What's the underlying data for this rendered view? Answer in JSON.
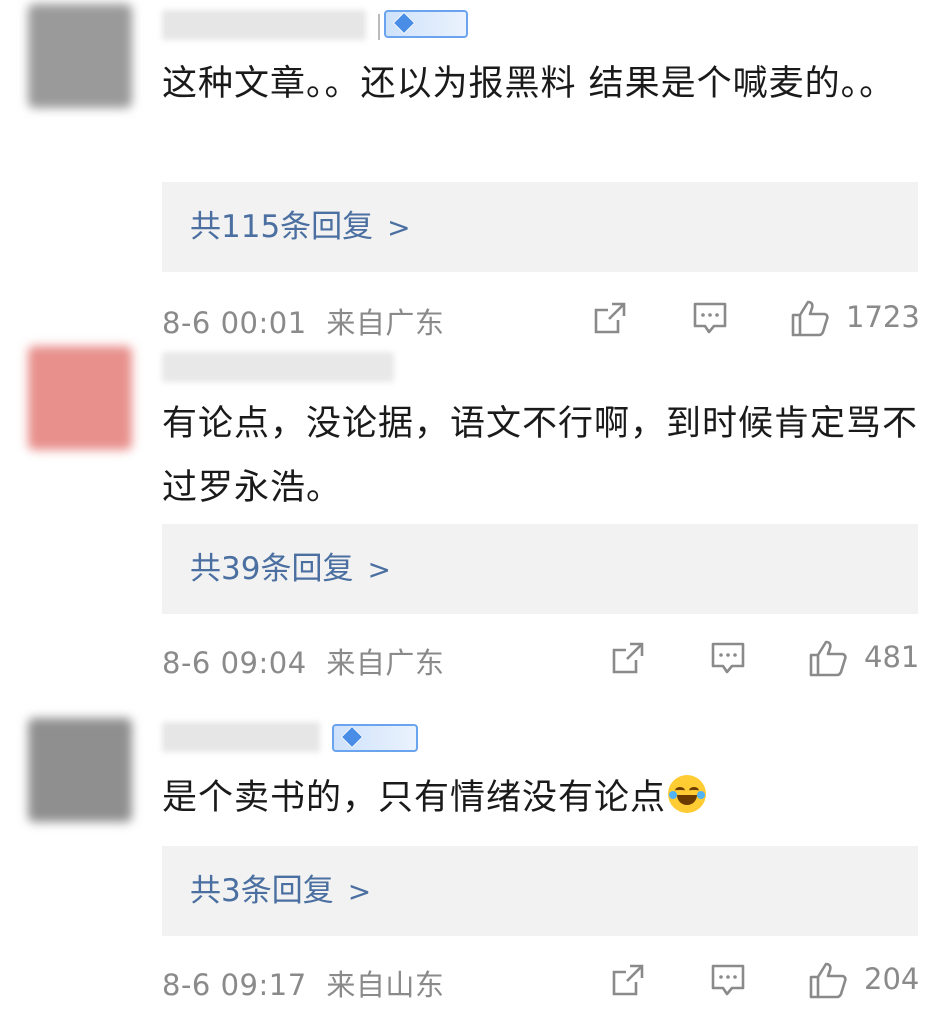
{
  "comments": [
    {
      "avatar_color": "#9a9a9a",
      "has_badge": true,
      "text": "这种文章。。还以为报黑料 结果是个喊麦的。。",
      "reply_label": "共115条回复",
      "time": "8-6 00:01",
      "location": "来自广东",
      "likes": "1723"
    },
    {
      "avatar_color": "#e8908c",
      "has_badge": false,
      "text": "有论点，没论据，语文不行啊，到时候肯定骂不过罗永浩。",
      "reply_label": "共39条回复",
      "time": "8-6 09:04",
      "location": "来自广东",
      "likes": "481"
    },
    {
      "avatar_color": "#8f8f8f",
      "has_badge": true,
      "text": "是个卖书的，只有情绪没有论点",
      "reply_label": "共3条回复",
      "time": "8-6 09:17",
      "location": "来自山东",
      "likes": "204"
    }
  ],
  "icons": {
    "repost": "repost-icon",
    "comment": "comment-icon",
    "like": "thumbs-up-icon",
    "emoji": "laughing-tears-emoji",
    "badge": "member-diamond-badge-icon"
  },
  "colors": {
    "reply_link": "#4a6fa0",
    "meta_text": "#8a8a8a",
    "reply_bg": "#f2f2f2"
  }
}
